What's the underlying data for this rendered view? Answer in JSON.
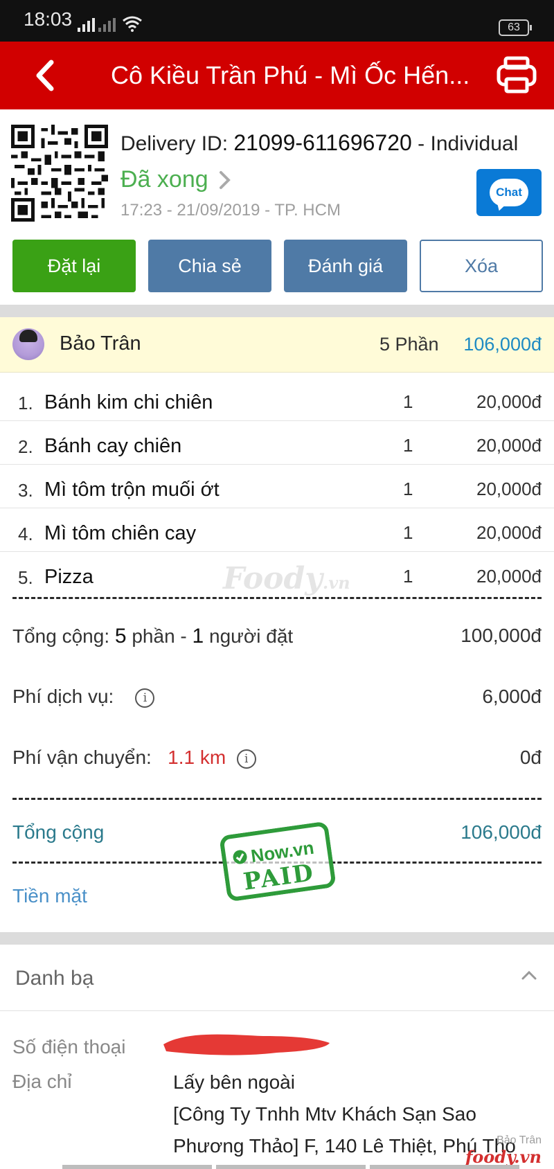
{
  "status_bar": {
    "time": "18:03",
    "battery": "63"
  },
  "header": {
    "title": "Cô Kiều Trần Phú - Mì Ốc Hến...",
    "back_icon": "arrow-back-icon",
    "print_icon": "printer-icon",
    "bg_color": "#d10000"
  },
  "order": {
    "delivery_prefix": "Delivery ID:",
    "delivery_id": "21099-611696720",
    "delivery_suffix": "- Individual",
    "status": "Đã xong",
    "meta": "17:23 - 21/09/2019 - TP. HCM",
    "chat_label": "Chat"
  },
  "actions": {
    "reorder": "Đặt lại",
    "share": "Chia sẻ",
    "rate": "Đánh giá",
    "delete": "Xóa"
  },
  "member": {
    "name": "Bảo Trân",
    "count": "5 Phần",
    "amount": "106,000đ"
  },
  "items": [
    {
      "index": "1.",
      "name": "Bánh kim chi chiên",
      "qty": "1",
      "price": "20,000đ"
    },
    {
      "index": "2.",
      "name": "Bánh cay chiên",
      "qty": "1",
      "price": "20,000đ"
    },
    {
      "index": "3.",
      "name": "Mì tôm trộn muối ớt",
      "qty": "1",
      "price": "20,000đ"
    },
    {
      "index": "4.",
      "name": "Mì tôm chiên cay",
      "qty": "1",
      "price": "20,000đ"
    },
    {
      "index": "5.",
      "name": "Pizza",
      "qty": "1",
      "price": "20,000đ"
    }
  ],
  "watermark": {
    "brand": "Foody",
    "suffix": ".vn"
  },
  "summary": {
    "subtotal_prefix": "Tổng cộng:",
    "subtotal_count": "5",
    "subtotal_mid": "phần -",
    "subtotal_people": "1",
    "subtotal_suffix": "người đặt",
    "subtotal_value": "100,000đ",
    "service_label": "Phí dịch vụ:",
    "service_value": "6,000đ",
    "shipping_label": "Phí vận chuyển:",
    "shipping_distance": "1.1 km",
    "shipping_value": "0đ",
    "total_label": "Tổng cộng",
    "total_value": "106,000đ",
    "payment_method": "Tiền mặt"
  },
  "stamp": {
    "top": "Now.vn",
    "bottom": "PAID"
  },
  "contacts": {
    "section_title": "Danh bạ",
    "phone_label": "Số điện thoại",
    "address_label": "Địa chỉ",
    "address_line1": "Lấy bên ngoài",
    "address_line2": "[Công Ty Tnhh Mtv Khách Sạn Sao",
    "address_line3": "Phương Thảo] F, 140 Lê Thiệt, Phú Thọ"
  },
  "corner_brand": {
    "user": "Bảo Trân",
    "logo": "foody.vn"
  }
}
